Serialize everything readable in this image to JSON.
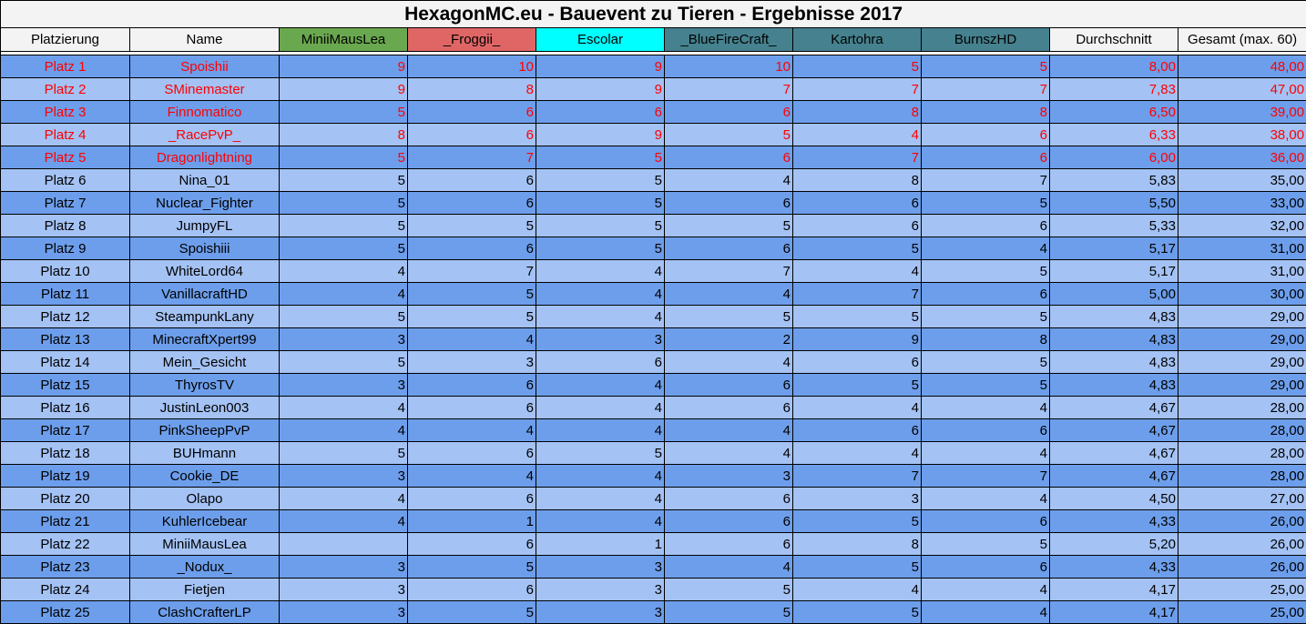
{
  "title": "HexagonMC.eu - Bauevent zu Tieren - Ergebnisse 2017",
  "columns": [
    {
      "label": "Platzierung",
      "bg": "#f3f3f3"
    },
    {
      "label": "Name",
      "bg": "#f3f3f3"
    },
    {
      "label": "MiniiMausLea",
      "bg": "#6aa84f"
    },
    {
      "label": "_Froggii_",
      "bg": "#e06666"
    },
    {
      "label": "Escolar",
      "bg": "#00ffff"
    },
    {
      "label": "_BlueFireCraft_",
      "bg": "#45818e"
    },
    {
      "label": "Kartohra",
      "bg": "#45818e"
    },
    {
      "label": "BurnszHD",
      "bg": "#45818e"
    },
    {
      "label": "Durchschnitt",
      "bg": "#f3f3f3"
    },
    {
      "label": "Gesamt (max. 60)",
      "bg": "#f3f3f3"
    }
  ],
  "highlight_color": "#ff0000",
  "rows": [
    {
      "place": "Platz 1",
      "name": "Spoishii",
      "scores": [
        "9",
        "10",
        "9",
        "10",
        "5",
        "5"
      ],
      "avg": "8,00",
      "total": "48,00",
      "top": true
    },
    {
      "place": "Platz 2",
      "name": "SMinemaster",
      "scores": [
        "9",
        "8",
        "9",
        "7",
        "7",
        "7"
      ],
      "avg": "7,83",
      "total": "47,00",
      "top": true
    },
    {
      "place": "Platz 3",
      "name": "Finnomatico",
      "scores": [
        "5",
        "6",
        "6",
        "6",
        "8",
        "8"
      ],
      "avg": "6,50",
      "total": "39,00",
      "top": true
    },
    {
      "place": "Platz 4",
      "name": "_RacePvP_",
      "scores": [
        "8",
        "6",
        "9",
        "5",
        "4",
        "6"
      ],
      "avg": "6,33",
      "total": "38,00",
      "top": true
    },
    {
      "place": "Platz 5",
      "name": "Dragonlightning",
      "scores": [
        "5",
        "7",
        "5",
        "6",
        "7",
        "6"
      ],
      "avg": "6,00",
      "total": "36,00",
      "top": true
    },
    {
      "place": "Platz 6",
      "name": "Nina_01",
      "scores": [
        "5",
        "6",
        "5",
        "4",
        "8",
        "7"
      ],
      "avg": "5,83",
      "total": "35,00",
      "top": false
    },
    {
      "place": "Platz 7",
      "name": "Nuclear_Fighter",
      "scores": [
        "5",
        "6",
        "5",
        "6",
        "6",
        "5"
      ],
      "avg": "5,50",
      "total": "33,00",
      "top": false
    },
    {
      "place": "Platz 8",
      "name": "JumpyFL",
      "scores": [
        "5",
        "5",
        "5",
        "5",
        "6",
        "6"
      ],
      "avg": "5,33",
      "total": "32,00",
      "top": false
    },
    {
      "place": "Platz 9",
      "name": "Spoishiii",
      "scores": [
        "5",
        "6",
        "5",
        "6",
        "5",
        "4"
      ],
      "avg": "5,17",
      "total": "31,00",
      "top": false
    },
    {
      "place": "Platz 10",
      "name": "WhiteLord64",
      "scores": [
        "4",
        "7",
        "4",
        "7",
        "4",
        "5"
      ],
      "avg": "5,17",
      "total": "31,00",
      "top": false
    },
    {
      "place": "Platz 11",
      "name": "VanillacraftHD",
      "scores": [
        "4",
        "5",
        "4",
        "4",
        "7",
        "6"
      ],
      "avg": "5,00",
      "total": "30,00",
      "top": false
    },
    {
      "place": "Platz 12",
      "name": "SteampunkLany",
      "scores": [
        "5",
        "5",
        "4",
        "5",
        "5",
        "5"
      ],
      "avg": "4,83",
      "total": "29,00",
      "top": false
    },
    {
      "place": "Platz 13",
      "name": "MinecraftXpert99",
      "scores": [
        "3",
        "4",
        "3",
        "2",
        "9",
        "8"
      ],
      "avg": "4,83",
      "total": "29,00",
      "top": false
    },
    {
      "place": "Platz 14",
      "name": "Mein_Gesicht",
      "scores": [
        "5",
        "3",
        "6",
        "4",
        "6",
        "5"
      ],
      "avg": "4,83",
      "total": "29,00",
      "top": false
    },
    {
      "place": "Platz 15",
      "name": "ThyrosTV",
      "scores": [
        "3",
        "6",
        "4",
        "6",
        "5",
        "5"
      ],
      "avg": "4,83",
      "total": "29,00",
      "top": false
    },
    {
      "place": "Platz 16",
      "name": "JustinLeon003",
      "scores": [
        "4",
        "6",
        "4",
        "6",
        "4",
        "4"
      ],
      "avg": "4,67",
      "total": "28,00",
      "top": false
    },
    {
      "place": "Platz 17",
      "name": "PinkSheepPvP",
      "scores": [
        "4",
        "4",
        "4",
        "4",
        "6",
        "6"
      ],
      "avg": "4,67",
      "total": "28,00",
      "top": false
    },
    {
      "place": "Platz 18",
      "name": "BUHmann",
      "scores": [
        "5",
        "6",
        "5",
        "4",
        "4",
        "4"
      ],
      "avg": "4,67",
      "total": "28,00",
      "top": false
    },
    {
      "place": "Platz 19",
      "name": "Cookie_DE",
      "scores": [
        "3",
        "4",
        "4",
        "3",
        "7",
        "7"
      ],
      "avg": "4,67",
      "total": "28,00",
      "top": false
    },
    {
      "place": "Platz 20",
      "name": "Olapo",
      "scores": [
        "4",
        "6",
        "4",
        "6",
        "3",
        "4"
      ],
      "avg": "4,50",
      "total": "27,00",
      "top": false
    },
    {
      "place": "Platz 21",
      "name": "KuhlerIcebear",
      "scores": [
        "4",
        "1",
        "4",
        "6",
        "5",
        "6"
      ],
      "avg": "4,33",
      "total": "26,00",
      "top": false
    },
    {
      "place": "Platz 22",
      "name": "MiniiMausLea",
      "scores": [
        "",
        "6",
        "1",
        "6",
        "8",
        "5"
      ],
      "avg": "5,20",
      "total": "26,00",
      "top": false
    },
    {
      "place": "Platz 23",
      "name": "_Nodux_",
      "scores": [
        "3",
        "5",
        "3",
        "4",
        "5",
        "6"
      ],
      "avg": "4,33",
      "total": "26,00",
      "top": false
    },
    {
      "place": "Platz 24",
      "name": "Fietjen",
      "scores": [
        "3",
        "6",
        "3",
        "5",
        "4",
        "4"
      ],
      "avg": "4,17",
      "total": "25,00",
      "top": false
    },
    {
      "place": "Platz 25",
      "name": "ClashCrafterLP",
      "scores": [
        "3",
        "5",
        "3",
        "5",
        "5",
        "4"
      ],
      "avg": "4,17",
      "total": "25,00",
      "top": false
    }
  ]
}
